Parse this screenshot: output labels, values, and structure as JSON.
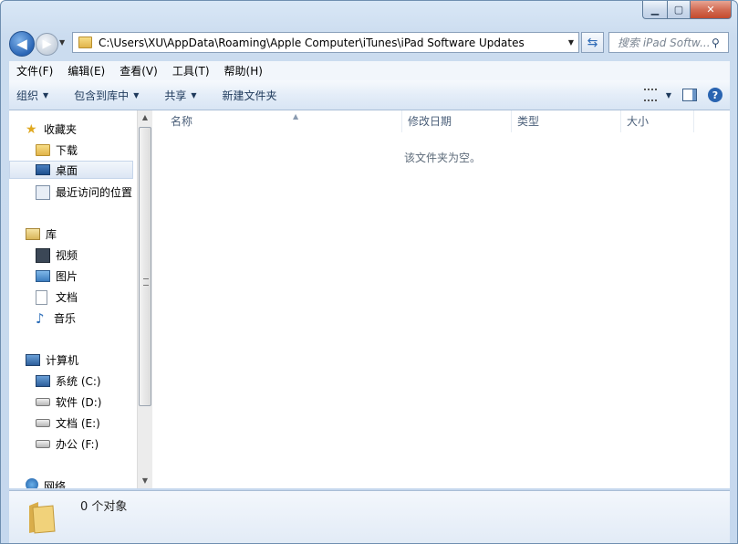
{
  "window": {
    "minimize_glyph": "▁",
    "maximize_glyph": "▢",
    "close_glyph": "✕"
  },
  "nav": {
    "back_glyph": "◀",
    "forward_glyph": "▶",
    "address_path": "C:\\Users\\XU\\AppData\\Roaming\\Apple Computer\\iTunes\\iPad Software Updates",
    "refresh_glyph": "⇆",
    "search_placeholder": "搜索 iPad Softw...",
    "search_icon": "search-icon"
  },
  "menubar": {
    "items": [
      "文件(F)",
      "编辑(E)",
      "查看(V)",
      "工具(T)",
      "帮助(H)"
    ]
  },
  "commandbar": {
    "organize": "组织",
    "include_in_library": "包含到库中",
    "share": "共享",
    "new_folder": "新建文件夹",
    "help_glyph": "?"
  },
  "navpane": {
    "favorites": "收藏夹",
    "downloads": "下载",
    "desktop": "桌面",
    "recent_places": "最近访问的位置",
    "libraries": "库",
    "videos": "视频",
    "pictures": "图片",
    "documents": "文档",
    "music": "音乐",
    "computer": "计算机",
    "drive_c": "系统 (C:)",
    "drive_d": "软件 (D:)",
    "drive_e": "文档 (E:)",
    "drive_f": "办公 (F:)",
    "network": "网络",
    "selected": "desktop"
  },
  "columns": {
    "name": "名称",
    "date_modified": "修改日期",
    "type": "类型",
    "size": "大小"
  },
  "filepane": {
    "empty_message": "该文件夹为空。"
  },
  "status": {
    "item_count": "0 个对象"
  }
}
